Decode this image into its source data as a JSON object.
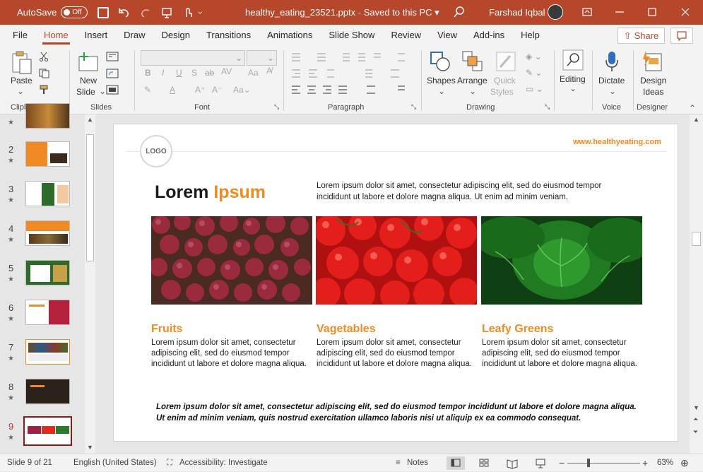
{
  "titlebar": {
    "autosave_label": "AutoSave",
    "autosave_state": "Off",
    "filename": "healthy_eating_23521.pptx",
    "save_status": "Saved to this PC",
    "user": "Farshad Iqbal"
  },
  "tabs": [
    "File",
    "Home",
    "Insert",
    "Draw",
    "Design",
    "Transitions",
    "Animations",
    "Slide Show",
    "Review",
    "View",
    "Add-ins",
    "Help"
  ],
  "share_label": "Share",
  "ribbon": {
    "paste": "Paste",
    "new_slide_1": "New",
    "new_slide_2": "Slide",
    "shapes": "Shapes",
    "arrange": "Arrange",
    "quick_styles_1": "Quick",
    "quick_styles_2": "Styles",
    "editing": "Editing",
    "dictate": "Dictate",
    "design_ideas_1": "Design",
    "design_ideas_2": "Ideas",
    "groups": {
      "clipboard": "Clipboard",
      "slides": "Slides",
      "font": "Font",
      "paragraph": "Paragraph",
      "drawing": "Drawing",
      "voice": "Voice",
      "designer": "Designer"
    }
  },
  "thumbnails": [
    "2",
    "3",
    "4",
    "5",
    "6",
    "7",
    "8",
    "9"
  ],
  "slide": {
    "logo": "LOGO",
    "url": "www.healthyeating.com",
    "title_main": "Lorem",
    "title_accent": "Ipsum",
    "intro": "Lorem ipsum dolor sit amet, consectetur adipiscing elit, sed do eiusmod tempor incididunt ut labore et dolore magna aliqua. Ut enim ad minim veniam.",
    "columns": [
      {
        "heading": "Fruits",
        "text": "Lorem ipsum dolor sit amet, consectetur adipiscing elit, sed do eiusmod tempor incididunt ut labore et dolore magna aliqua."
      },
      {
        "heading": "Vagetables",
        "text": "Lorem ipsum dolor sit amet, consectetur adipiscing elit, sed do eiusmod tempor incididunt ut labore et dolore magna aliqua."
      },
      {
        "heading": "Leafy Greens",
        "text": "Lorem ipsum dolor sit amet, consectetur adipiscing elit, sed do eiusmod tempor incididunt ut labore et dolore magna aliqua."
      }
    ],
    "quote": "Lorem ipsum dolor sit amet, consectetur adipiscing elit, sed do eiusmod tempor incididunt ut labore et dolore magna aliqua. Ut enim ad minim veniam, quis nostrud exercitation ullamco laboris nisi ut aliquip ex ea commodo consequat."
  },
  "status": {
    "slide_count": "Slide 9 of 21",
    "language": "English (United States)",
    "accessibility": "Accessibility: Investigate",
    "notes": "Notes",
    "zoom": "63%"
  },
  "colors": {
    "brand": "#b7472a",
    "accent_orange": "#f08a24",
    "selected_thumb": "#8c1a1a"
  }
}
